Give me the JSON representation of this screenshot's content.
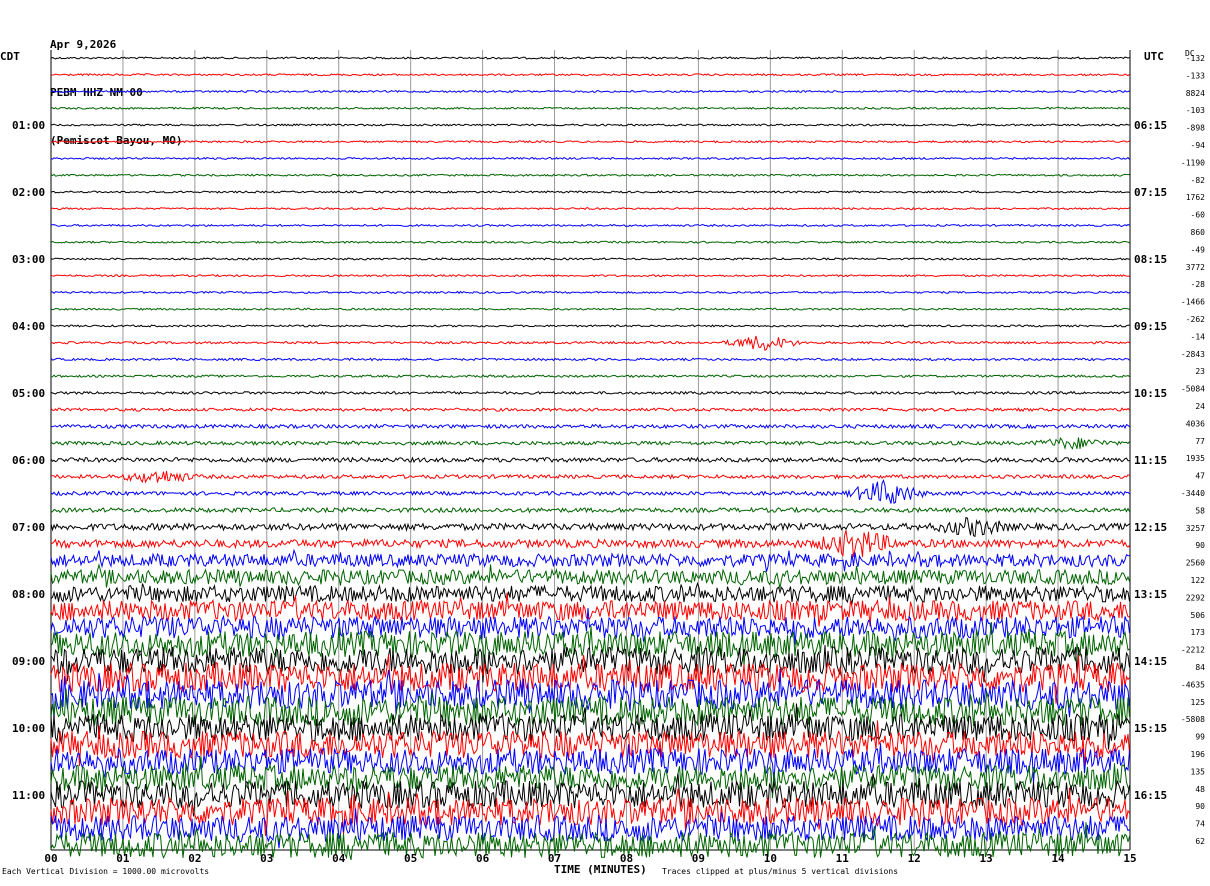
{
  "header": {
    "date": "Apr 9,2026",
    "station": "PEBM HHZ NM 00",
    "location": "(Pemiscot Bayou, MO)"
  },
  "left_axis_label": "CDT",
  "right_axis_label": "UTC",
  "dc_label": "DC",
  "footer": {
    "left": "Each Vertical Division = 1000.00 microvolts",
    "center": "TIME (MINUTES)",
    "right": "Traces clipped at plus/minus 5 vertical divisions"
  },
  "colors": {
    "trace_cycle": [
      "#000000",
      "#ff0000",
      "#0000ff",
      "#006400"
    ],
    "grid": "#999999"
  },
  "chart_data": {
    "type": "line",
    "description_kind": "helicorder",
    "x_ticks": [
      "00",
      "01",
      "02",
      "03",
      "04",
      "05",
      "06",
      "07",
      "08",
      "09",
      "10",
      "11",
      "12",
      "13",
      "14",
      "15"
    ],
    "xlim": [
      0,
      15
    ],
    "xlabel": "TIME (MINUTES)",
    "row_count": 48,
    "row_minutes": 15,
    "left_time_labels": [
      {
        "row": 4,
        "label": "01:00"
      },
      {
        "row": 8,
        "label": "02:00"
      },
      {
        "row": 12,
        "label": "03:00"
      },
      {
        "row": 16,
        "label": "04:00"
      },
      {
        "row": 20,
        "label": "05:00"
      },
      {
        "row": 24,
        "label": "06:00"
      },
      {
        "row": 28,
        "label": "07:00"
      },
      {
        "row": 32,
        "label": "08:00"
      },
      {
        "row": 36,
        "label": "09:00"
      },
      {
        "row": 40,
        "label": "10:00"
      },
      {
        "row": 44,
        "label": "11:00"
      }
    ],
    "right_time_labels": [
      {
        "row": 4,
        "label": "06:15"
      },
      {
        "row": 8,
        "label": "07:15"
      },
      {
        "row": 12,
        "label": "08:15"
      },
      {
        "row": 16,
        "label": "09:15"
      },
      {
        "row": 20,
        "label": "10:15"
      },
      {
        "row": 24,
        "label": "11:15"
      },
      {
        "row": 28,
        "label": "12:15"
      },
      {
        "row": 32,
        "label": "13:15"
      },
      {
        "row": 36,
        "label": "14:15"
      },
      {
        "row": 40,
        "label": "15:15"
      },
      {
        "row": 44,
        "label": "16:15"
      }
    ],
    "dc_offsets": [
      "-132",
      "-133",
      "8824",
      "-103",
      "-898",
      "-94",
      "-1190",
      "-82",
      "1762",
      "-60",
      "860",
      "-49",
      "3772",
      "-28",
      "-1466",
      "-262",
      "-14",
      "-2843",
      "23",
      "-5084",
      "24",
      "4036",
      "77",
      "1935",
      "47",
      "-3440",
      "58",
      "3257",
      "90",
      "2560",
      "122",
      "2292",
      "506",
      "173",
      "-2212",
      "84",
      "-4635",
      "125",
      "-5808",
      "99",
      "196",
      "135",
      "48",
      "90",
      "74",
      "62"
    ],
    "noise_levels": [
      0.05,
      0.05,
      0.05,
      0.05,
      0.05,
      0.05,
      0.05,
      0.05,
      0.05,
      0.05,
      0.05,
      0.05,
      0.05,
      0.05,
      0.05,
      0.05,
      0.05,
      0.06,
      0.06,
      0.06,
      0.07,
      0.08,
      0.1,
      0.1,
      0.12,
      0.1,
      0.1,
      0.12,
      0.18,
      0.22,
      0.35,
      0.4,
      0.45,
      0.55,
      0.6,
      0.7,
      0.75,
      0.8,
      0.8,
      0.8,
      0.75,
      0.75,
      0.7,
      0.7,
      0.75,
      0.75,
      0.7,
      0.7
    ],
    "events": [
      {
        "row": 17,
        "minute": 9.9,
        "amplitude": 0.3
      },
      {
        "row": 25,
        "minute": 1.5,
        "amplitude": 0.25
      },
      {
        "row": 26,
        "minute": 11.6,
        "amplitude": 0.5
      },
      {
        "row": 23,
        "minute": 14.2,
        "amplitude": 0.2
      },
      {
        "row": 28,
        "minute": 12.8,
        "amplitude": 0.3
      },
      {
        "row": 29,
        "minute": 11.2,
        "amplitude": 0.5
      }
    ]
  }
}
